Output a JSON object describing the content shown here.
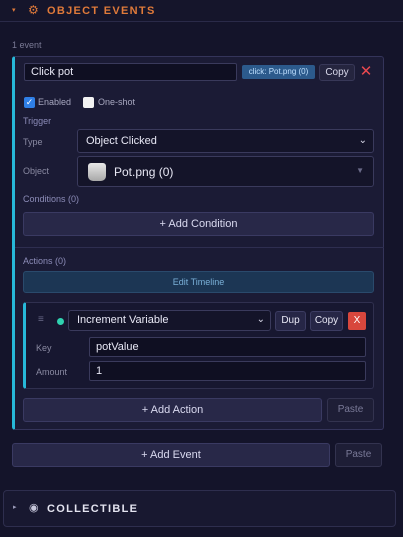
{
  "section": {
    "title": "OBJECT EVENTS",
    "caret": "▾",
    "icon": "gear-icon",
    "event_count": "1 event"
  },
  "event": {
    "name_value": "Click pot",
    "summary_chip": "click: Pot.png (0)",
    "copy_label": "Copy",
    "delete_glyph": "✕",
    "enabled_label": "Enabled",
    "enabled_checked": true,
    "oneshot_label": "One-shot",
    "oneshot_checked": false,
    "trigger_heading": "Trigger",
    "type_label": "Type",
    "type_value": "Object Clicked",
    "object_label": "Object",
    "object_value": "Pot.png (0)",
    "conditions_heading": "Conditions (0)",
    "add_condition_label": "+ Add Condition",
    "actions_heading": "Actions (0)",
    "edit_timeline_label": "Edit Timeline",
    "action": {
      "grip": "≡",
      "type_value": "Increment Variable",
      "dup_label": "Dup",
      "copy_label": "Copy",
      "delete_glyph": "X",
      "key_label": "Key",
      "key_value": "potValue",
      "amount_label": "Amount",
      "amount_value": "1"
    },
    "add_action_label": "+ Add Action",
    "paste_action_label": "Paste"
  },
  "add_event_label": "+ Add Event",
  "paste_event_label": "Paste",
  "collectible": {
    "caret": "▸",
    "icon": "target-icon",
    "title": "COLLECTIBLE"
  },
  "colors": {
    "background": "#14142a",
    "accent_orange": "#e07a3a",
    "accent_cyan": "#27b8d8",
    "delete_red": "#e8484f"
  }
}
